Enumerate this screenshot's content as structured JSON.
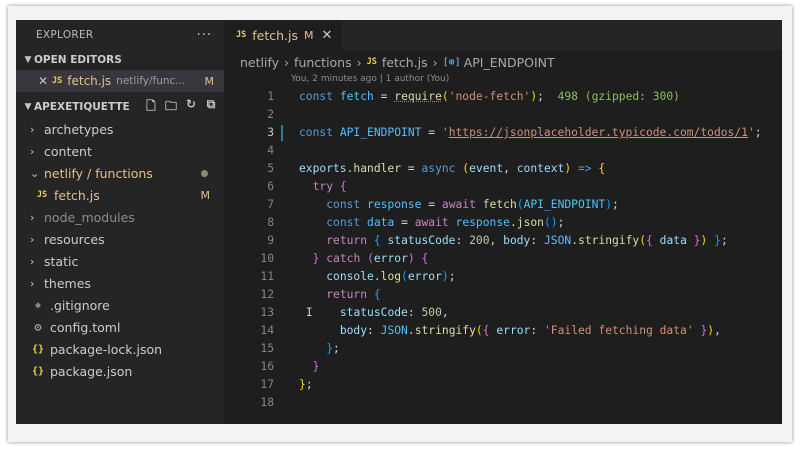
{
  "sidebar": {
    "title": "EXPLORER",
    "more": "···",
    "open_editors": {
      "label": "OPEN EDITORS",
      "items": [
        {
          "close": "✕",
          "badge": "JS",
          "name": "fetch.js",
          "path": "netlify/func...",
          "status": "M"
        }
      ]
    },
    "project": {
      "label": "APEXETIQUETTE",
      "items": [
        {
          "label": "archetypes"
        },
        {
          "label": "content"
        },
        {
          "label": "netlify / functions"
        },
        {
          "badge": "JS",
          "label": "fetch.js",
          "status": "M"
        },
        {
          "label": "node_modules"
        },
        {
          "label": "resources"
        },
        {
          "label": "static"
        },
        {
          "label": "themes"
        },
        {
          "label": ".gitignore"
        },
        {
          "label": "config.toml"
        },
        {
          "badge": "{}",
          "label": "package-lock.json"
        },
        {
          "badge": "{}",
          "label": "package.json"
        }
      ]
    }
  },
  "editor": {
    "tab": {
      "badge": "JS",
      "name": "fetch.js",
      "status": "M",
      "close": "✕"
    },
    "breadcrumb": [
      "netlify",
      "functions",
      "fetch.js",
      "API_ENDPOINT"
    ],
    "breadcrumb_badge": "JS",
    "breadcrumb_symbol": "[⊕]",
    "codelens": "You, 2 minutes ago | 1 author (You)",
    "line_numbers": [
      "1",
      "2",
      "3",
      "4",
      "5",
      "6",
      "7",
      "8",
      "9",
      "10",
      "11",
      "12",
      "13",
      "14",
      "15",
      "16",
      "17",
      "18"
    ],
    "import_cost": "498 (gzipped: 300)",
    "api_url": "https://jsonplaceholder.typicode.com/todos/1",
    "error_message": "Failed fetching data"
  }
}
